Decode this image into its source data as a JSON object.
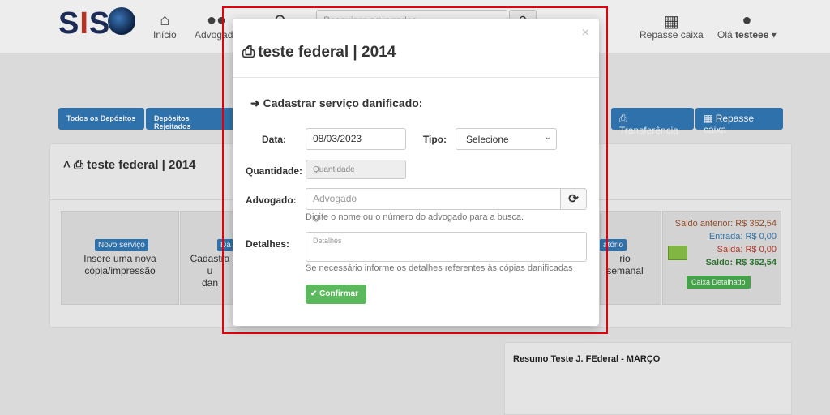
{
  "header": {
    "logo_text": [
      "S",
      "I",
      "S"
    ],
    "nav": [
      {
        "label": "Início",
        "icon": "home-icon"
      },
      {
        "label": "Advogado",
        "icon": "users-icon"
      },
      {
        "label": "",
        "icon": "search-icon"
      }
    ],
    "search_placeholder": "Pesquisar advogados",
    "repasse_label": "Repasse caixa",
    "user_greeting": "Olá",
    "user_name": "testeee"
  },
  "tabs": [
    {
      "label": "Todos os Depósitos"
    },
    {
      "label": "Depósitos Rejeitados"
    }
  ],
  "actions": {
    "transfer_label": "Transferência",
    "repasse_label": "Repasse caixa"
  },
  "panel": {
    "title": "teste federal | 2014",
    "cards": [
      {
        "badge": "Novo serviço",
        "text_line1": "Insere uma nova",
        "text_line2": "cópia/impressão"
      },
      {
        "badge": "Da",
        "text_line1": "Cadastra u",
        "text_line2": "dan"
      },
      {
        "badge": "atório",
        "text_line1": "rio semanal",
        "text_line2": ""
      }
    ],
    "cash": {
      "saldo_anterior": "Saldo anterior: R$ 362,54",
      "entrada": "Entrada: R$ 0,00",
      "saida": "Saída: R$ 0,00",
      "saldo": "Saldo: R$ 362,54",
      "button": "Caixa Detalhado"
    },
    "summary_title": "Resumo Teste J. FEderal - MARÇO"
  },
  "modal": {
    "title": "teste federal | 2014",
    "close": "×",
    "subtitle": "Cadastrar serviço danificado:",
    "data_label": "Data:",
    "data_value": "08/03/2023",
    "tipo_label": "Tipo:",
    "tipo_value": "Selecione",
    "quantidade_label": "Quantidade:",
    "quantidade_placeholder": "Quantidade",
    "advogado_label": "Advogado:",
    "advogado_placeholder": "Advogado",
    "advogado_help": "Digite o nome ou o número do advogado para a busca.",
    "detalhes_label": "Detalhes:",
    "detalhes_placeholder": "Detalhes",
    "detalhes_help": "Se necessário informe os detalhes referentes às cópias danificadas",
    "confirm_label": "Confirmar"
  },
  "colors": {
    "primary": "#337ab7",
    "success": "#5cb85c",
    "highlight": "#e3000f"
  }
}
